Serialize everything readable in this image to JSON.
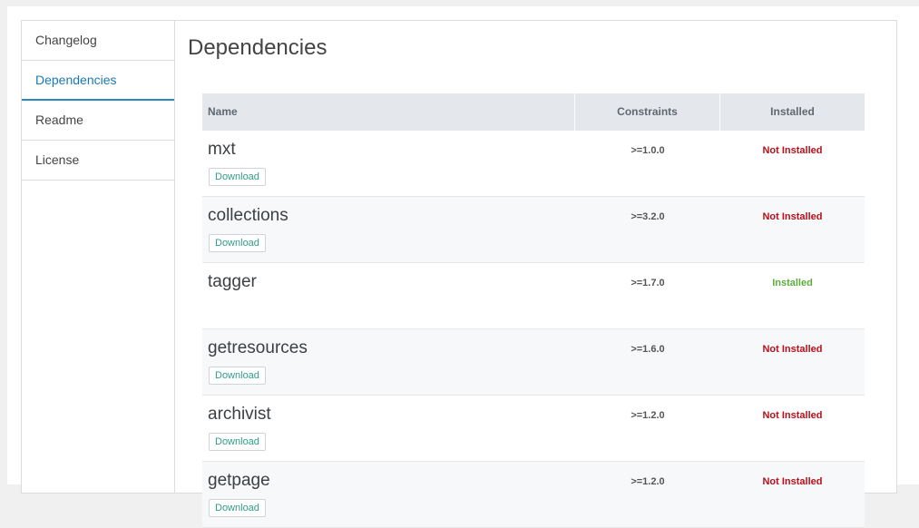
{
  "sidebar": {
    "tabs": [
      {
        "label": "Changelog",
        "active": false
      },
      {
        "label": "Dependencies",
        "active": true
      },
      {
        "label": "Readme",
        "active": false
      },
      {
        "label": "License",
        "active": false
      }
    ]
  },
  "main": {
    "title": "Dependencies",
    "table": {
      "headers": {
        "name": "Name",
        "constraints": "Constraints",
        "installed": "Installed"
      },
      "rows": [
        {
          "name": "mxt",
          "constraint": ">=1.0.0",
          "status": "Not Installed",
          "download": "Download"
        },
        {
          "name": "collections",
          "constraint": ">=3.2.0",
          "status": "Not Installed",
          "download": "Download"
        },
        {
          "name": "tagger",
          "constraint": ">=1.7.0",
          "status": "Installed",
          "download": ""
        },
        {
          "name": "getresources",
          "constraint": ">=1.6.0",
          "status": "Not Installed",
          "download": "Download"
        },
        {
          "name": "archivist",
          "constraint": ">=1.2.0",
          "status": "Not Installed",
          "download": "Download"
        },
        {
          "name": "getpage",
          "constraint": ">=1.2.0",
          "status": "Not Installed",
          "download": "Download"
        }
      ]
    }
  },
  "colors": {
    "active_tab": "#1a7ab4",
    "not_installed": "#b8101a",
    "installed": "#5aaf3b",
    "download_text": "#2f9c8a",
    "header_bg": "#e4e8ed"
  }
}
